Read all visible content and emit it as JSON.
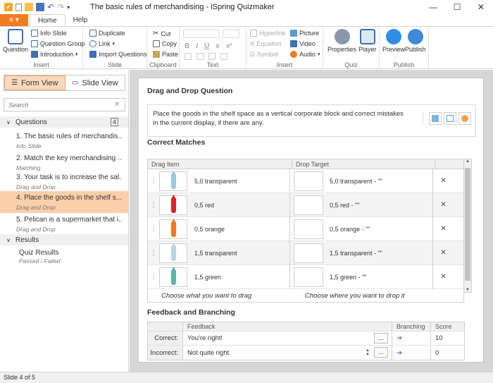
{
  "window": {
    "title": "The basic rules of merchandising - iSpring Quizmaker",
    "minimize": "—",
    "maximize": "☐",
    "close": "✕"
  },
  "ribbon": {
    "file_label": "≡ ▾",
    "tabs": [
      "Home",
      "Help"
    ],
    "groups": {
      "insert": {
        "label": "Insert",
        "question": "Question",
        "info_slide": "Info Slide",
        "question_group": "Question Group",
        "introduction": "Introduction"
      },
      "slide": {
        "label": "Slide",
        "duplicate": "Duplicate",
        "link": "Link",
        "import_questions": "Import Questions"
      },
      "clipboard": {
        "label": "Clipboard",
        "cut": "Cut",
        "copy": "Copy",
        "paste": "Paste"
      },
      "text": {
        "label": "Text"
      },
      "insert2": {
        "label": "Insert",
        "hyperlink": "Hyperlink",
        "equation": "Equation",
        "symbol": "Symbol",
        "picture": "Picture",
        "video": "Video",
        "audio": "Audio"
      },
      "quiz": {
        "label": "Quiz",
        "properties": "Properties",
        "player": "Player"
      },
      "publish": {
        "label": "Publish",
        "preview": "Preview",
        "publish": "Publish"
      }
    }
  },
  "sidebar": {
    "form_view": "Form View",
    "slide_view": "Slide View",
    "search_placeholder": "Search",
    "questions_header": "Questions",
    "questions_count": "4",
    "questions": [
      {
        "title": "1.  The basic rules of merchandis...",
        "type": "Info Slide"
      },
      {
        "title": "2.  Match the key merchandising ...",
        "type": "Matching"
      },
      {
        "title": "3.  Your task is to increase the sal...",
        "type": "Drag and Drop"
      },
      {
        "title": "4.  Place the goods in the shelf s...",
        "type": "Drag and Drop"
      },
      {
        "title": "5.  Pelican is a supermarket that i...",
        "type": "Drag and Drop"
      }
    ],
    "results_header": "Results",
    "results_items": [
      {
        "title": "Quiz Results",
        "sub": "Passed / Failed"
      }
    ]
  },
  "editor": {
    "question_heading": "Drag and Drop Question",
    "question_text": "Place the goods in the shelf space as a vertical corporate block and correct mistakes in the current display, if there are any.",
    "matches_heading": "Correct Matches",
    "matches_columns": {
      "drag_item": "Drag Item",
      "drop_target": "Drop Target"
    },
    "matches": [
      {
        "item": "5,0  transparent",
        "target": "5,0  transparent - \"\""
      },
      {
        "item": "0,5 red",
        "target": "0,5 red - \"\""
      },
      {
        "item": "0,5  orange",
        "target": "0,5  orange - \"\""
      },
      {
        "item": "1,5 transparent",
        "target": "1,5 transparent - \"\""
      },
      {
        "item": "1,5 green",
        "target": "1,5 green - \"\""
      }
    ],
    "bottle_colors": [
      "#9fc7dd",
      "#d9262b",
      "#f07a21",
      "#b8d4e3",
      "#5fb3a8"
    ],
    "drag_hint": "Choose what you want to drag",
    "drop_hint": "Choose where you want to drop it",
    "feedback_heading": "Feedback and Branching",
    "feedback_columns": {
      "feedback": "Feedback",
      "branching": "Branching",
      "score": "Score"
    },
    "feedback_rows": [
      {
        "label": "Correct:",
        "text": "You're right!",
        "branch": "➔",
        "score": "10"
      },
      {
        "label": "Incorrect:",
        "text": "Not quite right.",
        "branch": "➔",
        "score": "0"
      }
    ],
    "ellipsis": "..."
  },
  "status": {
    "slide_text": "Slide 4 of 5"
  },
  "colors": {
    "accent": "#f07c22",
    "selection": "#fbcfa9",
    "link": "#2a7bd4"
  }
}
